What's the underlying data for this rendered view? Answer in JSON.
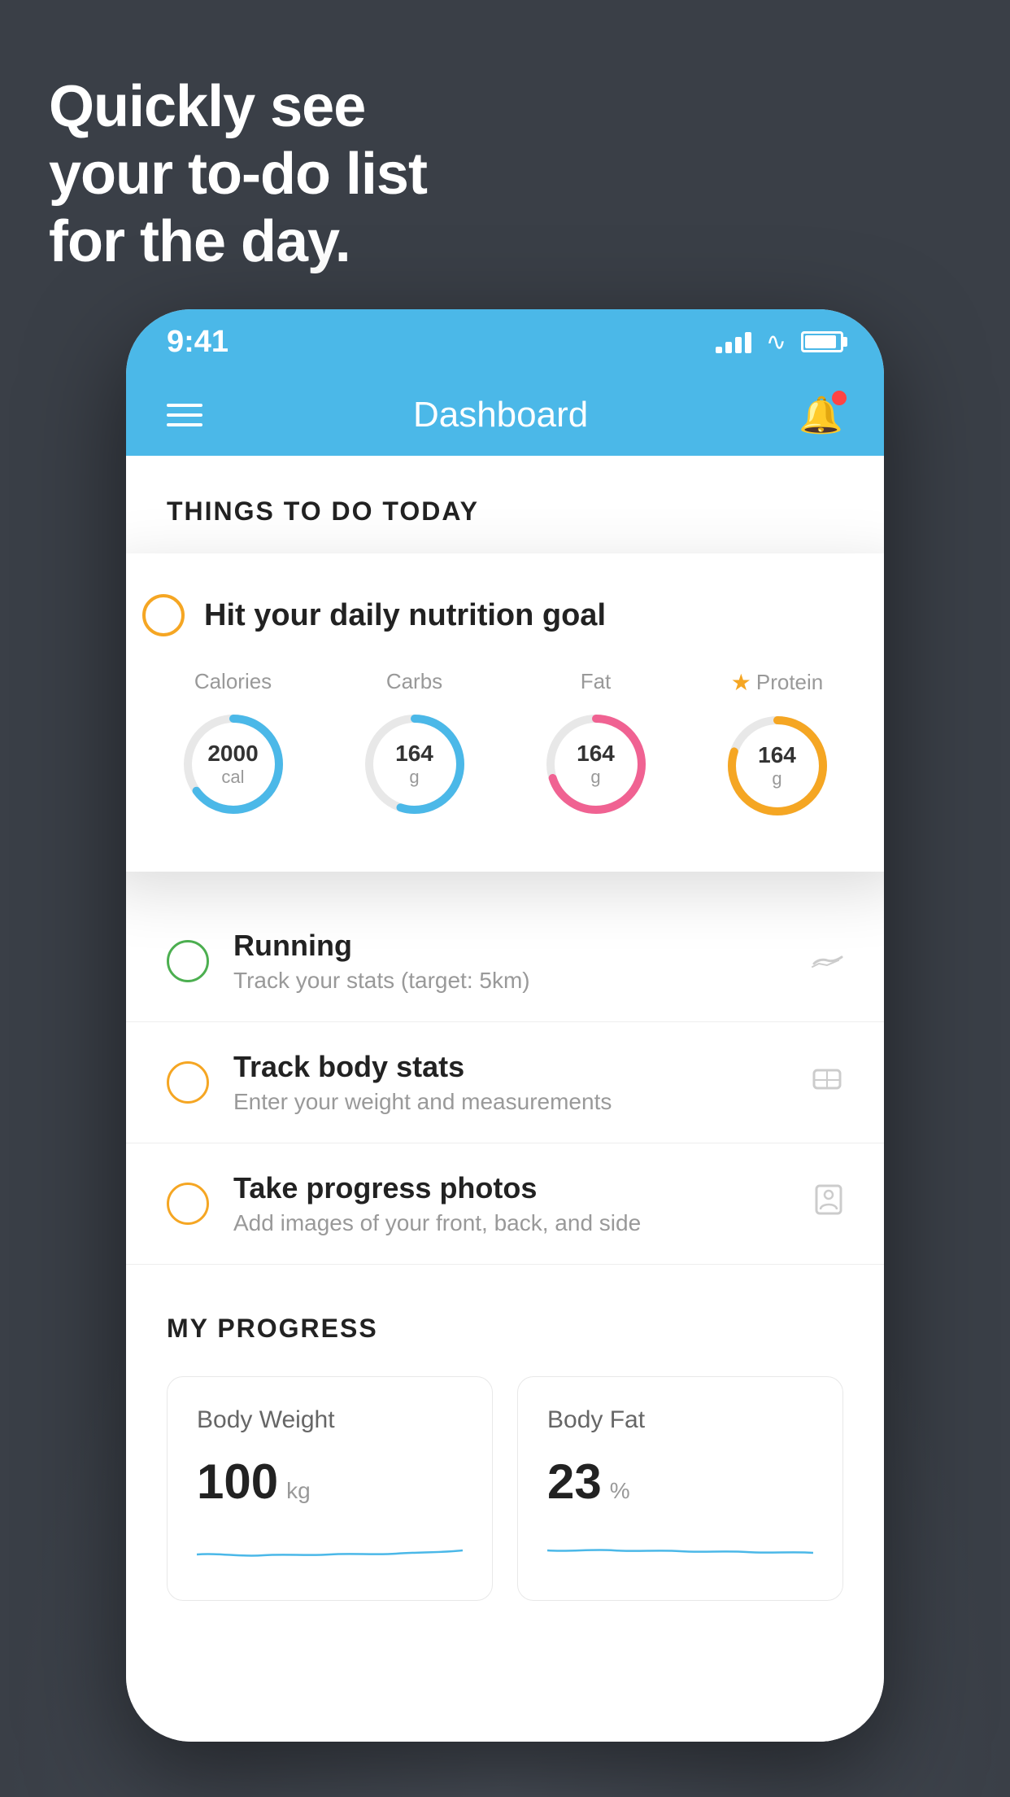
{
  "background_color": "#3a3f47",
  "hero": {
    "line1": "Quickly see",
    "line2": "your to-do list",
    "line3": "for the day."
  },
  "status_bar": {
    "time": "9:41",
    "signal": "signal",
    "wifi": "wifi",
    "battery": "battery"
  },
  "header": {
    "title": "Dashboard",
    "menu_label": "menu",
    "bell_label": "notifications"
  },
  "things_section": {
    "title": "THINGS TO DO TODAY"
  },
  "nutrition_card": {
    "circle_color": "#f5a623",
    "title": "Hit your daily nutrition goal",
    "items": [
      {
        "label": "Calories",
        "value": "2000",
        "unit": "cal",
        "color": "#4bb8e8",
        "percent": 65
      },
      {
        "label": "Carbs",
        "value": "164",
        "unit": "g",
        "color": "#4bb8e8",
        "percent": 55
      },
      {
        "label": "Fat",
        "value": "164",
        "unit": "g",
        "color": "#f06292",
        "percent": 70
      },
      {
        "label": "Protein",
        "value": "164",
        "unit": "g",
        "color": "#f5a623",
        "percent": 80,
        "starred": true
      }
    ]
  },
  "todo_items": [
    {
      "title": "Running",
      "subtitle": "Track your stats (target: 5km)",
      "circle_color": "green",
      "icon": "🏃"
    },
    {
      "title": "Track body stats",
      "subtitle": "Enter your weight and measurements",
      "circle_color": "yellow",
      "icon": "⚖"
    },
    {
      "title": "Take progress photos",
      "subtitle": "Add images of your front, back, and side",
      "circle_color": "yellow",
      "icon": "👤"
    }
  ],
  "progress_section": {
    "title": "MY PROGRESS",
    "cards": [
      {
        "title": "Body Weight",
        "value": "100",
        "unit": "kg"
      },
      {
        "title": "Body Fat",
        "value": "23",
        "unit": "%"
      }
    ]
  }
}
